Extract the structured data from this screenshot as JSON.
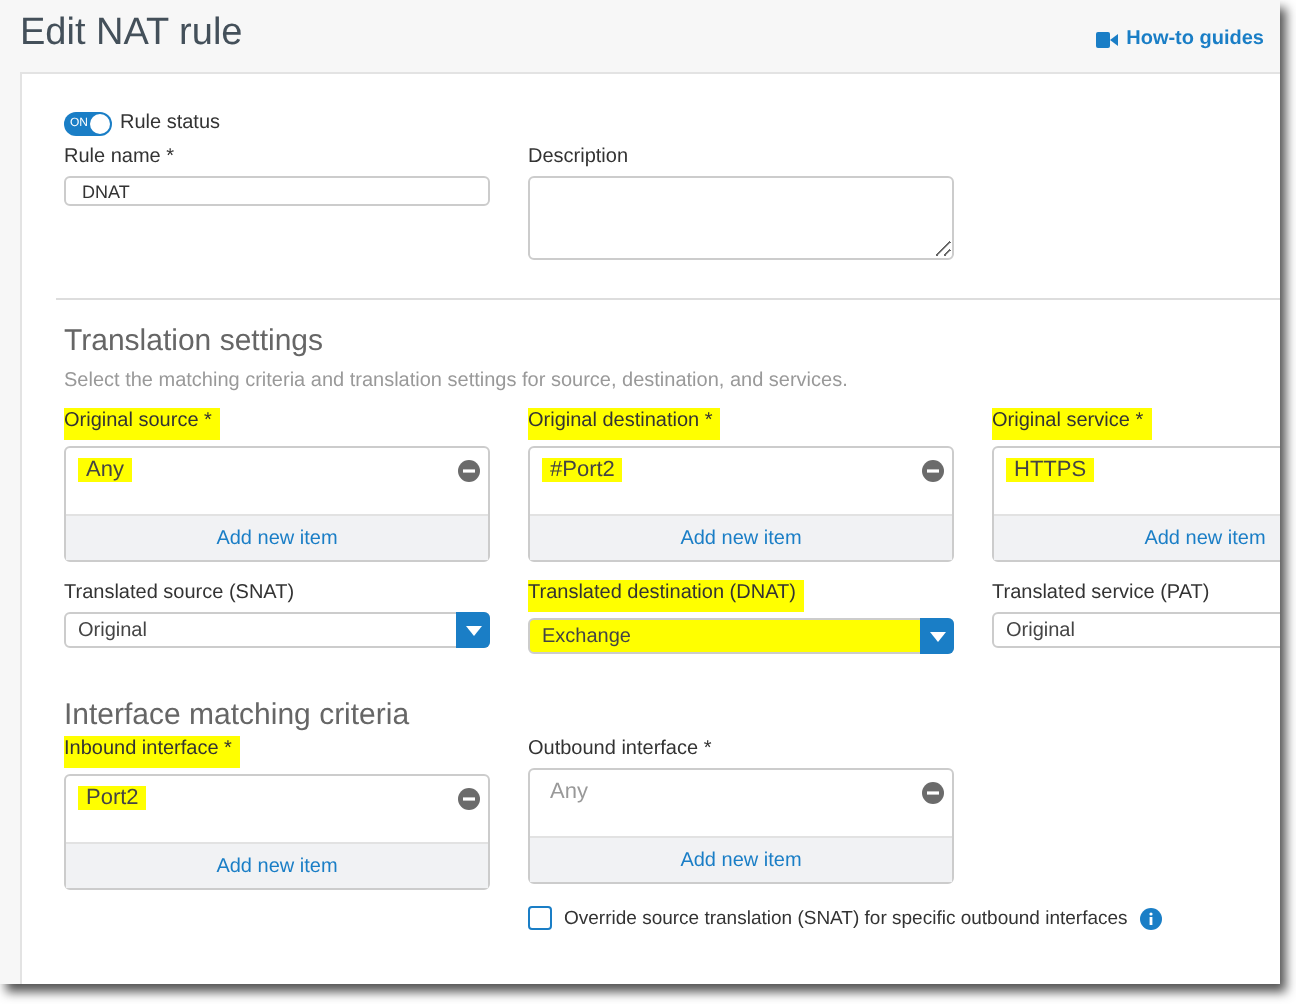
{
  "title": "Edit NAT rule",
  "guides_link": "How-to guides",
  "rule_status": {
    "label": "Rule status",
    "on": true,
    "switch_text": "ON"
  },
  "rule_name": {
    "label": "Rule name *",
    "value": "DNAT"
  },
  "description": {
    "label": "Description"
  },
  "translation": {
    "heading": "Translation settings",
    "subtitle": "Select the matching criteria and translation settings for source, destination, and services.",
    "fields": [
      {
        "kind": "list",
        "label": "Original source *",
        "items": [
          "Any"
        ],
        "add_label": "Add new item",
        "highlighted": true
      },
      {
        "kind": "list",
        "label": "Original destination *",
        "items": [
          "#Port2"
        ],
        "add_label": "Add new item",
        "highlighted": true
      },
      {
        "kind": "list",
        "label": "Original service *",
        "items": [
          "HTTPS"
        ],
        "add_label": "Add new item",
        "highlighted": true
      },
      {
        "kind": "select",
        "label": "Translated source (SNAT)",
        "value": "Original",
        "highlighted": false
      },
      {
        "kind": "select",
        "label": "Translated destination (DNAT)",
        "value": "Exchange",
        "highlighted": true
      },
      {
        "kind": "select",
        "label": "Translated service (PAT)",
        "value": "Original",
        "highlighted": false
      }
    ]
  },
  "interface": {
    "heading": "Interface matching criteria",
    "fields": [
      {
        "kind": "list",
        "label": "Inbound interface *",
        "items": [
          "Port2"
        ],
        "add_label": "Add new item",
        "highlighted": true
      },
      {
        "kind": "list",
        "label": "Outbound interface *",
        "items": [
          "Any"
        ],
        "add_label": "Add new item",
        "highlighted": false
      }
    ],
    "override": {
      "label": "Override source translation (SNAT) for specific outbound interfaces",
      "checked": false
    }
  }
}
